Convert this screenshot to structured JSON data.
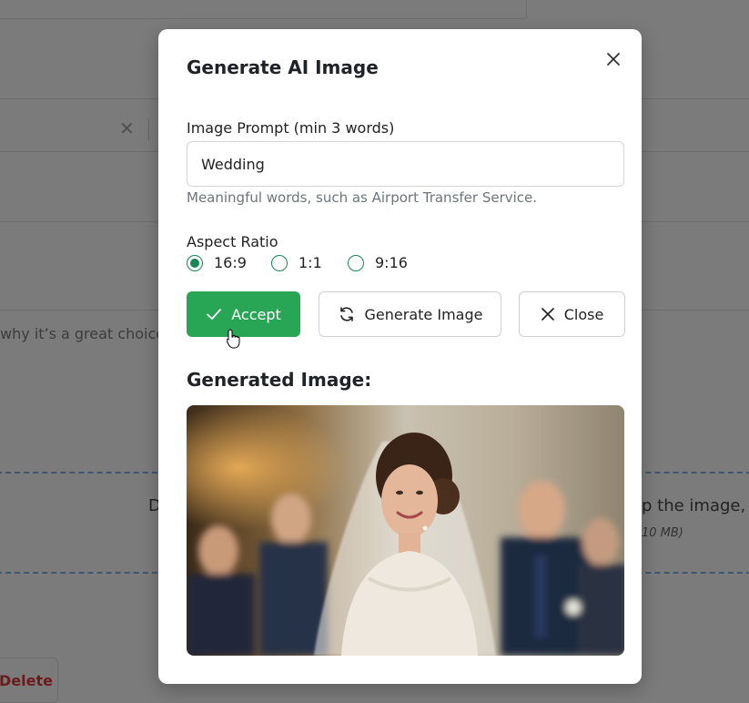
{
  "background": {
    "snippet_text": "why it’s a great choice",
    "drop_left_text": "D",
    "drop_right_text": "p the image,",
    "drop_right_subtext": "10 MB)",
    "delete_label": "Delete"
  },
  "modal": {
    "title": "Generate AI Image",
    "prompt": {
      "label": "Image Prompt (min 3 words)",
      "value": "Wedding",
      "hint": "Meaningful words, such as Airport Transfer Service."
    },
    "aspect_ratio": {
      "label": "Aspect Ratio",
      "options": [
        "16:9",
        "1:1",
        "9:16"
      ],
      "selected": "16:9"
    },
    "buttons": {
      "accept": "Accept",
      "generate": "Generate Image",
      "close": "Close"
    },
    "generated_heading": "Generated Image:"
  },
  "colors": {
    "accent_green": "#28a656",
    "radio_green": "#198754",
    "overlay": "#7b7b7b"
  }
}
